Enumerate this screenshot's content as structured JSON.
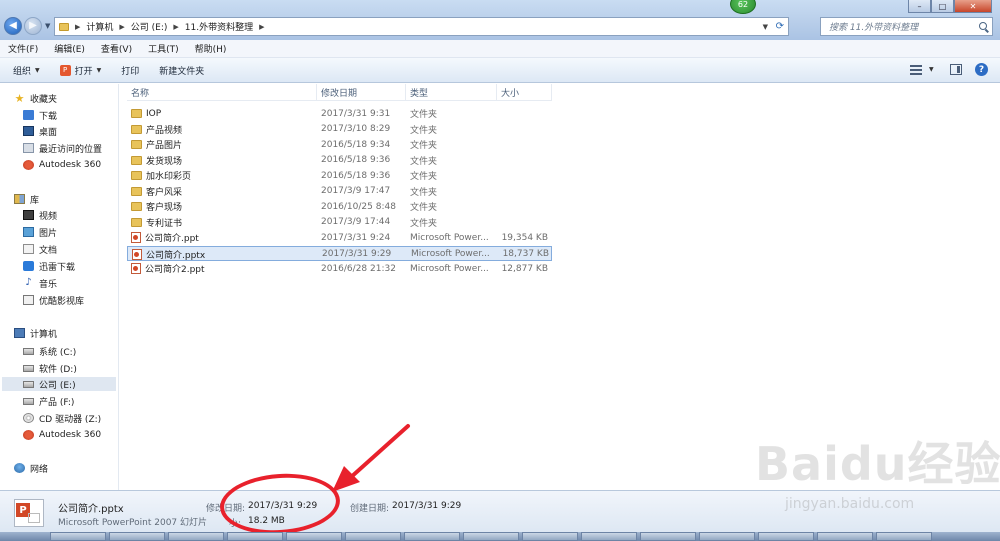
{
  "address": {
    "crumbs": [
      "计算机",
      "公司 (E:)",
      "11.外带资料整理"
    ],
    "search_placeholder": "搜索 11.外带资料整理"
  },
  "badge": "62",
  "menubar": [
    "文件(F)",
    "编辑(E)",
    "查看(V)",
    "工具(T)",
    "帮助(H)"
  ],
  "toolbar": {
    "organize": "组织",
    "open": "打开",
    "print": "打印",
    "new_folder": "新建文件夹"
  },
  "nav": {
    "favorites": [
      "收藏夹",
      "下载",
      "桌面",
      "最近访问的位置",
      "Autodesk 360"
    ],
    "libraries": [
      "库",
      "视频",
      "图片",
      "文档",
      "迅雷下载",
      "音乐",
      "优酷影视库"
    ],
    "computer": [
      "计算机",
      "系统 (C:)",
      "软件 (D:)",
      "公司 (E:)",
      "产品 (F:)",
      "CD 驱动器 (Z:)",
      "Autodesk 360"
    ],
    "network": "网络"
  },
  "columns": {
    "name": "名称",
    "date": "修改日期",
    "type": "类型",
    "size": "大小"
  },
  "files": [
    {
      "name": "IOP",
      "date": "2017/3/31 9:31",
      "type": "文件夹",
      "size": "",
      "kind": "folder"
    },
    {
      "name": "产品视频",
      "date": "2017/3/10 8:29",
      "type": "文件夹",
      "size": "",
      "kind": "folder"
    },
    {
      "name": "产品图片",
      "date": "2016/5/18 9:34",
      "type": "文件夹",
      "size": "",
      "kind": "folder"
    },
    {
      "name": "发货现场",
      "date": "2016/5/18 9:36",
      "type": "文件夹",
      "size": "",
      "kind": "folder"
    },
    {
      "name": "加水印彩页",
      "date": "2016/5/18 9:36",
      "type": "文件夹",
      "size": "",
      "kind": "folder"
    },
    {
      "name": "客户风采",
      "date": "2017/3/9 17:47",
      "type": "文件夹",
      "size": "",
      "kind": "folder"
    },
    {
      "name": "客户现场",
      "date": "2016/10/25 8:48",
      "type": "文件夹",
      "size": "",
      "kind": "folder"
    },
    {
      "name": "专利证书",
      "date": "2017/3/9 17:44",
      "type": "文件夹",
      "size": "",
      "kind": "folder"
    },
    {
      "name": "公司简介.ppt",
      "date": "2017/3/31 9:24",
      "type": "Microsoft Power...",
      "size": "19,354 KB",
      "kind": "ppt"
    },
    {
      "name": "公司简介.pptx",
      "date": "2017/3/31 9:29",
      "type": "Microsoft Power...",
      "size": "18,737 KB",
      "kind": "ppt",
      "selected": true
    },
    {
      "name": "公司简介2.ppt",
      "date": "2016/6/28 21:32",
      "type": "Microsoft Power...",
      "size": "12,877 KB",
      "kind": "ppt"
    }
  ],
  "details": {
    "name": "公司简介.pptx",
    "type": "Microsoft PowerPoint 2007 幻灯片",
    "modified_label": "修改日期:",
    "modified": "2017/3/31 9:29",
    "size_label": "小:",
    "size": "18.2 MB",
    "created_label": "创建日期:",
    "created": "2017/3/31 9:29"
  },
  "watermark": {
    "brand": "Baidu经验",
    "url": "jingyan.baidu.com"
  },
  "colors": {
    "highlight_ellipse": "#e8212c",
    "selection": "#dde9f8"
  }
}
